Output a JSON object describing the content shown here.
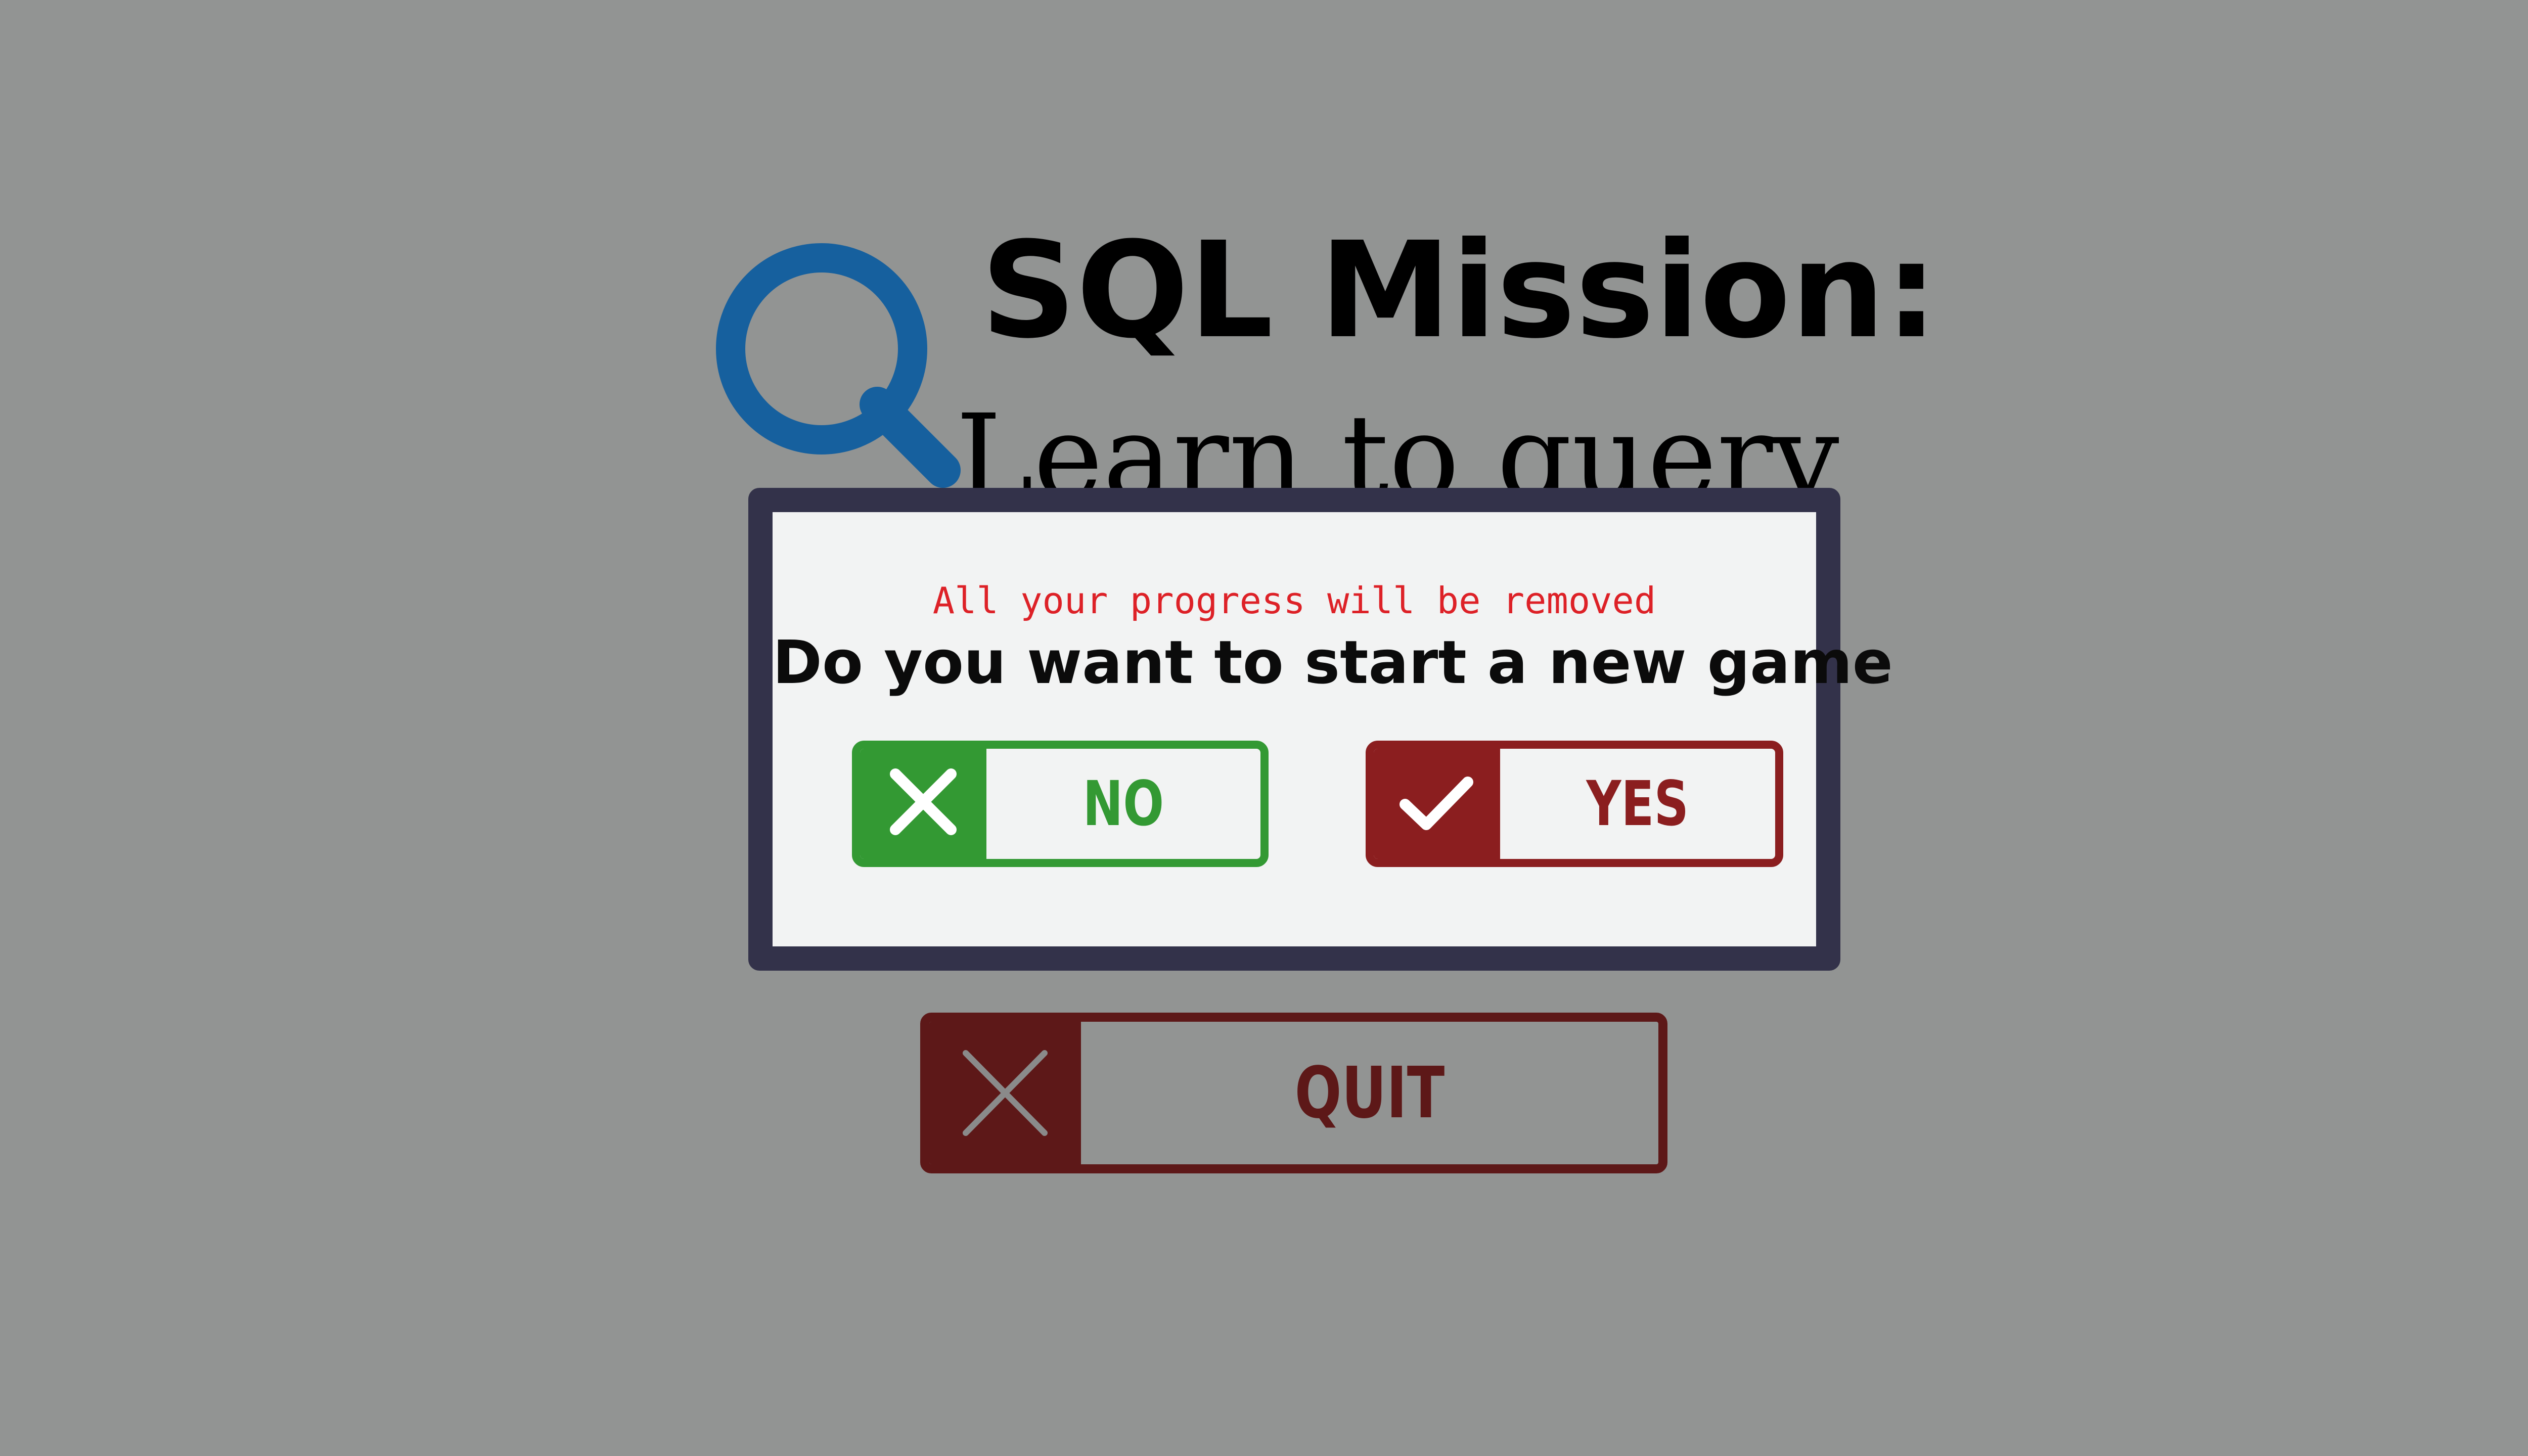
{
  "title_screen": {
    "title": "SQL Mission:",
    "subtitle": "Learn to query",
    "quit_label": "QUIT"
  },
  "dialog": {
    "warning": "All your progress will be removed",
    "question": "Do you want to start a new game",
    "no_label": "NO",
    "yes_label": "YES"
  },
  "icons": {
    "logo": "magnifier-icon",
    "no": "close-icon",
    "yes": "check-icon",
    "quit": "close-icon"
  },
  "colors": {
    "backdrop": "#929493",
    "modal_frame": "#33324a",
    "modal_body": "#f2f3f3",
    "warning": "#dd2127",
    "no_green": "#339933",
    "yes_red": "#8b1e1f",
    "quit_dark_red": "#5d1818",
    "magnifier_blue": "#16609e"
  }
}
